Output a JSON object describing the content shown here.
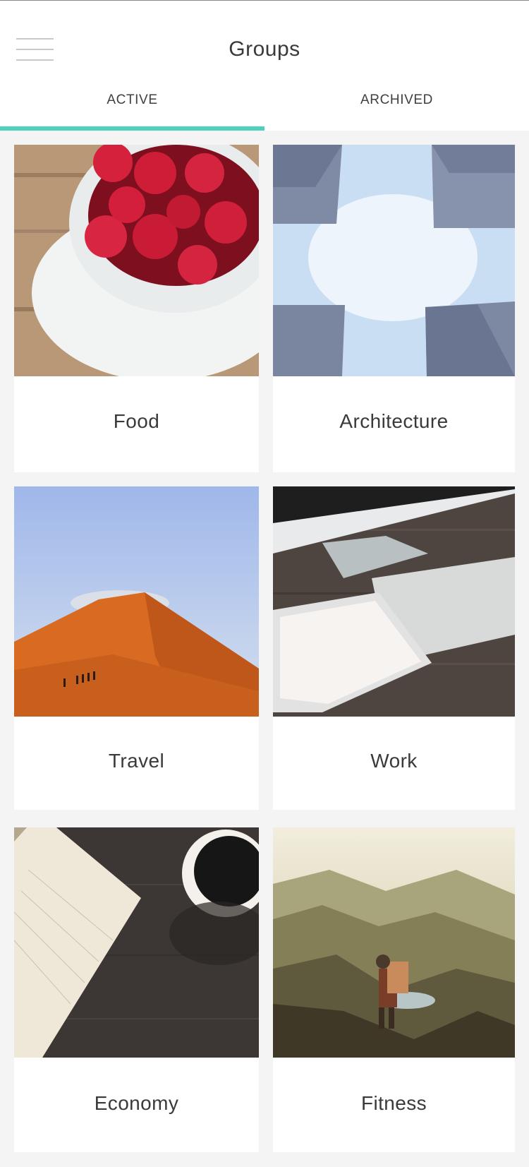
{
  "header": {
    "title": "Groups",
    "menu_icon": "hamburger-menu-icon"
  },
  "tabs": [
    {
      "label": "ACTIVE",
      "active": true
    },
    {
      "label": "ARCHIVED",
      "active": false
    }
  ],
  "colors": {
    "accent": "#4fd1bd",
    "background": "#f4f4f4",
    "card": "#ffffff",
    "text": "#3a3a3a"
  },
  "groups": [
    {
      "label": "Food",
      "image": "raspberries-bowl-photo"
    },
    {
      "label": "Architecture",
      "image": "skyscrapers-sky-photo"
    },
    {
      "label": "Travel",
      "image": "desert-dune-photo"
    },
    {
      "label": "Work",
      "image": "desk-computer-tablet-photo"
    },
    {
      "label": "Economy",
      "image": "notebook-coffee-photo"
    },
    {
      "label": "Fitness",
      "image": "hiker-mountains-photo"
    }
  ]
}
